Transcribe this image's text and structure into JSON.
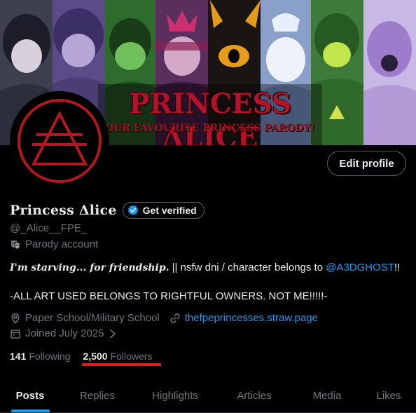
{
  "banner": {
    "title": "PRINCESS ΔLICE",
    "subtitle": "OUR FAVOURITE PRINCESS PARODY!"
  },
  "profile": {
    "edit_label": "Edit profile",
    "display_name": "Princess Δlice",
    "verify_label": "Get verified",
    "handle": "@_Alice__FPE_",
    "parody_label": "Parody account",
    "bio": {
      "fancy": "I'm starving... for friendship.",
      "text": " || nsfw dni  / character belongs to ",
      "mention": "@A3DGHOST",
      "end": "!!",
      "line2": "-ALL ART USED BELONGS TO RIGHTFUL OWNERS. NOT ME!!!!!-"
    },
    "location": "Paper School/Military School",
    "website": "thefpeprincesses.straw.page",
    "joined": "Joined July 2025"
  },
  "stats": {
    "following_count": "141",
    "following_label": "Following",
    "followers_count": "2,500",
    "followers_label": "Followers"
  },
  "tabs": [
    {
      "label": "Posts"
    },
    {
      "label": "Replies"
    },
    {
      "label": "Highlights"
    },
    {
      "label": "Articles"
    },
    {
      "label": "Media"
    },
    {
      "label": "Likes"
    }
  ],
  "colors": {
    "accent": "#1d9bf0",
    "muted": "#71767b",
    "annotation": "#e01b24"
  }
}
